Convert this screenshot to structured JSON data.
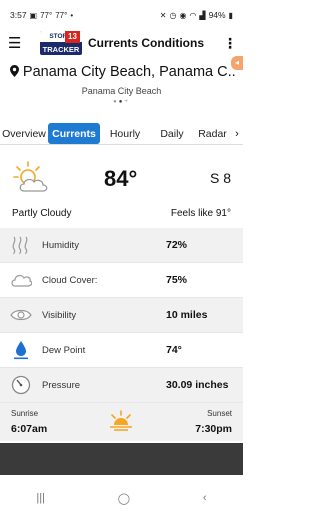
{
  "status_bar": {
    "time": "3:57",
    "left_icons": [
      "gallery-icon",
      "temperature-notification-icon",
      "temperature-notification-icon",
      "dot-icon"
    ],
    "left_temps": [
      "77°",
      "77°"
    ],
    "battery": "94%",
    "right_icons": [
      "mute-icon",
      "alarm-icon",
      "location-icon",
      "wifi-icon",
      "signal-icon",
      "battery-icon"
    ]
  },
  "app_bar": {
    "title": "Currents Conditions",
    "logo_top": "STORM",
    "logo_number": "13",
    "logo_bottom": "TRACKER",
    "menu_icon": "hamburger-menu-icon",
    "more_icon": "more-vertical-icon"
  },
  "location": {
    "name": "Panama City Beach, Panama C...",
    "subtitle": "Panama City Beach",
    "pin_icon": "location-pin-icon",
    "page_count": 3,
    "active_page": 1
  },
  "tabs": [
    {
      "label": "Overview"
    },
    {
      "label": "Currents"
    },
    {
      "label": "Hourly"
    },
    {
      "label": "Daily"
    },
    {
      "label": "Radar"
    }
  ],
  "active_tab": "Currents",
  "current": {
    "temperature": "84°",
    "wind": "S 8",
    "condition": "Partly Cloudy",
    "feels_like": "Feels like 91°",
    "icon": "partly-cloudy-icon"
  },
  "details": [
    {
      "label": "Humidity",
      "value": "72%",
      "icon": "humidity-icon"
    },
    {
      "label": "Cloud Cover:",
      "value": "75%",
      "icon": "cloud-icon"
    },
    {
      "label": "Visibility",
      "value": "10 miles",
      "icon": "eye-icon"
    },
    {
      "label": "Dew Point",
      "value": "74°",
      "icon": "dew-drop-icon"
    },
    {
      "label": "Pressure",
      "value": "30.09 inches",
      "icon": "gauge-icon"
    }
  ],
  "sun": {
    "sunrise_label": "Sunrise",
    "sunrise": "6:07am",
    "sunset_label": "Sunset",
    "sunset": "7:30pm",
    "icon": "sunrise-sunset-icon"
  },
  "colors": {
    "accent": "#1f7bd1",
    "sun": "#f5a623",
    "dew": "#1f6fd1",
    "logo_blue": "#1b2a6b",
    "logo_red": "#d7261e"
  }
}
